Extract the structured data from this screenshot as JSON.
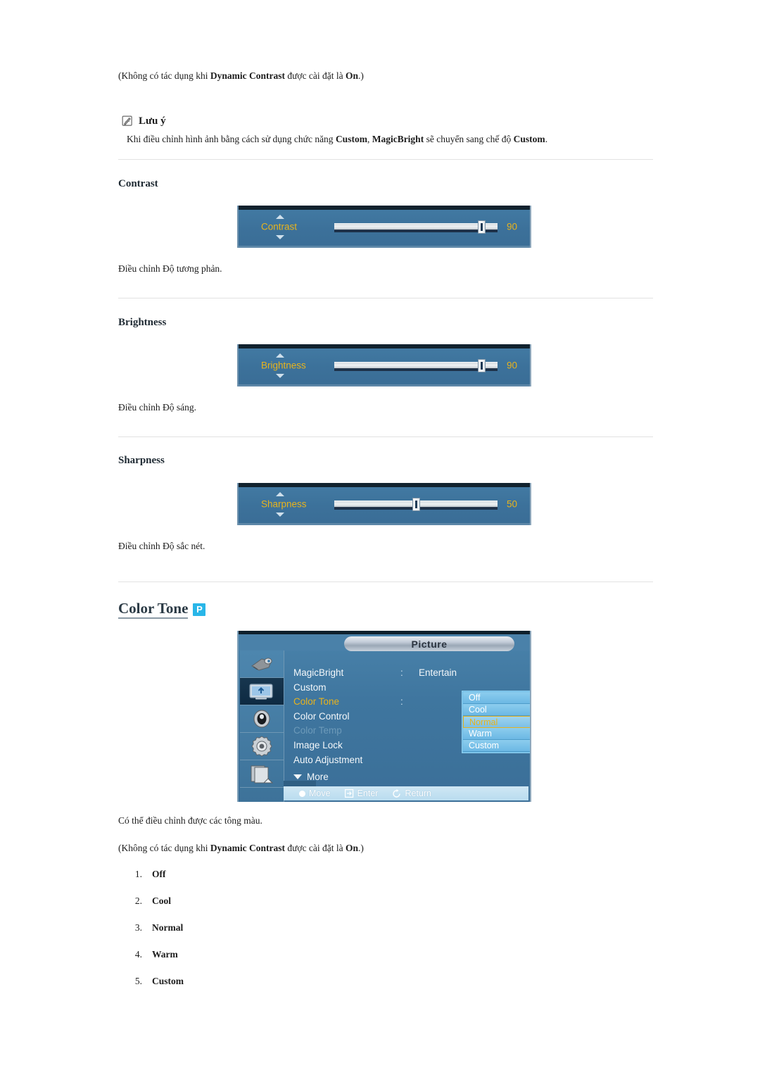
{
  "theme": {
    "osd_blue": "#3f769f",
    "osd_accent_yellow": "#e8b31d",
    "dropdown_blue": "#6cb8e4",
    "badge_cyan": "#29b6e8",
    "divider_gray": "#e2e2e2"
  },
  "top_note": {
    "prefix": "(Không có tác dụng khi ",
    "bold1": "Dynamic Contrast",
    "middle": " được cài đặt là ",
    "bold2": "On",
    "suffix": ".)"
  },
  "note_block": {
    "icon": "note-pencil-icon",
    "label": "Lưu ý",
    "text_prefix": "Khi điều chỉnh hình ảnh bằng cách sử dụng chức năng ",
    "bold1": "Custom",
    "text_mid": ", ",
    "bold2": "MagicBright",
    "text_mid2": " sẽ chuyển sang chế độ ",
    "bold3": "Custom",
    "text_suffix": "."
  },
  "sections": [
    {
      "heading": "Contrast",
      "caption": "Điều chỉnh Độ tương phản.",
      "osd": {
        "label": "Contrast",
        "value": "90",
        "value_pct": 90
      }
    },
    {
      "heading": "Brightness",
      "caption": "Điều chỉnh Độ sáng.",
      "osd": {
        "label": "Brightness",
        "value": "90",
        "value_pct": 90
      }
    },
    {
      "heading": "Sharpness",
      "caption": "Điều chỉnh Độ sắc nét.",
      "osd": {
        "label": "Sharpness",
        "value": "50",
        "value_pct": 50
      }
    }
  ],
  "color_tone": {
    "heading": "Color Tone",
    "badge": "P",
    "caption": "Có thể điều chỉnh được các tông màu.",
    "note": {
      "prefix": "(Không có tác dụng khi ",
      "bold1": "Dynamic Contrast",
      "middle": " được cài đặt là ",
      "bold2": "On",
      "suffix": ".)"
    },
    "options": [
      {
        "num": "1.",
        "label": "Off"
      },
      {
        "num": "2.",
        "label": "Cool"
      },
      {
        "num": "3.",
        "label": "Normal"
      },
      {
        "num": "4.",
        "label": "Warm"
      },
      {
        "num": "5.",
        "label": "Custom"
      }
    ]
  },
  "osd_menu": {
    "title": "Picture",
    "sidebar_icons": [
      {
        "name": "input-source-icon",
        "selected": false
      },
      {
        "name": "picture-icon",
        "selected": true
      },
      {
        "name": "sound-icon",
        "selected": false
      },
      {
        "name": "setup-gear-icon",
        "selected": false
      },
      {
        "name": "multi-control-icon",
        "selected": false
      }
    ],
    "items": [
      {
        "label": "MagicBright",
        "state": "normal",
        "has_colon": true,
        "value": "Entertain"
      },
      {
        "label": "Custom",
        "state": "normal",
        "has_colon": false,
        "value": ""
      },
      {
        "label": "Color Tone",
        "state": "active",
        "has_colon": true,
        "value": ""
      },
      {
        "label": "Color Control",
        "state": "normal",
        "has_colon": false,
        "value": ""
      },
      {
        "label": "Color Temp",
        "state": "disabled",
        "has_colon": false,
        "value": ""
      },
      {
        "label": "Image Lock",
        "state": "normal",
        "has_colon": false,
        "value": ""
      },
      {
        "label": "Auto Adjustment",
        "state": "normal",
        "has_colon": false,
        "value": ""
      }
    ],
    "more_label": "More",
    "dropdown": {
      "items": [
        {
          "label": "Off",
          "selected": false
        },
        {
          "label": "Cool",
          "selected": false
        },
        {
          "label": "Normal",
          "selected": true
        },
        {
          "label": "Warm",
          "selected": false
        },
        {
          "label": "Custom",
          "selected": false
        }
      ]
    },
    "footer": [
      {
        "icon": "move-dot-icon",
        "label": "Move"
      },
      {
        "icon": "enter-icon",
        "label": "Enter"
      },
      {
        "icon": "return-icon",
        "label": "Return"
      }
    ]
  }
}
